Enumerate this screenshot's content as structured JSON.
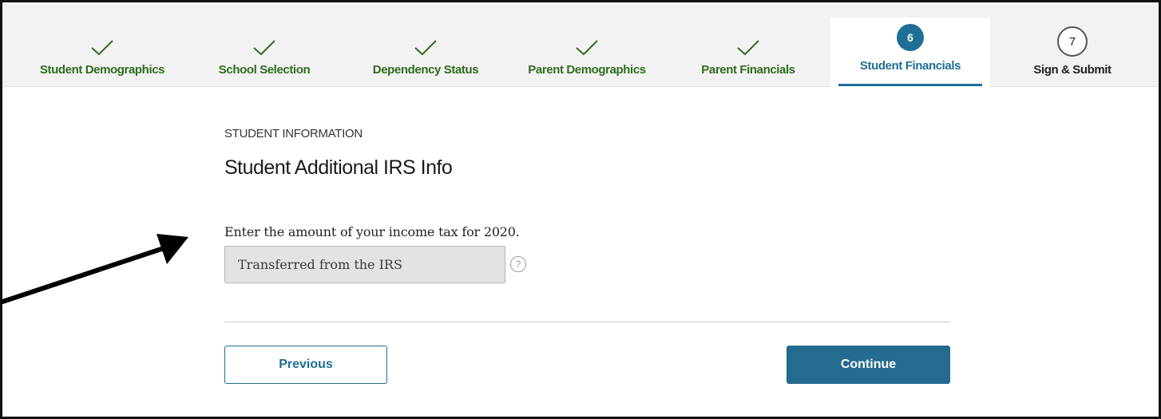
{
  "steps": [
    {
      "label": "Student Demographics",
      "status": "complete",
      "icon": "checkmark-icon"
    },
    {
      "label": "School Selection",
      "status": "complete",
      "icon": "checkmark-icon"
    },
    {
      "label": "Dependency Status",
      "status": "complete",
      "icon": "checkmark-icon"
    },
    {
      "label": "Parent Demographics",
      "status": "complete",
      "icon": "checkmark-icon"
    },
    {
      "label": "Parent Financials",
      "status": "complete",
      "icon": "checkmark-icon"
    },
    {
      "label": "Student Financials",
      "status": "current",
      "number": "6"
    },
    {
      "label": "Sign & Submit",
      "status": "upcoming",
      "number": "7"
    }
  ],
  "section": {
    "eyebrow": "STUDENT INFORMATION",
    "title": "Student Additional IRS Info"
  },
  "question": {
    "prompt": "Enter the amount of your income tax for 2020.",
    "value": "Transferred from the IRS",
    "help_icon": "question-circle-icon",
    "help_glyph": "?"
  },
  "buttons": {
    "previous": "Previous",
    "continue": "Continue"
  },
  "colors": {
    "complete": "#2f6b1e",
    "accent": "#1f6f95",
    "continue_bg": "#246b8f",
    "field_bg": "#e3e3e3",
    "annotation_arrow": "#000000"
  }
}
